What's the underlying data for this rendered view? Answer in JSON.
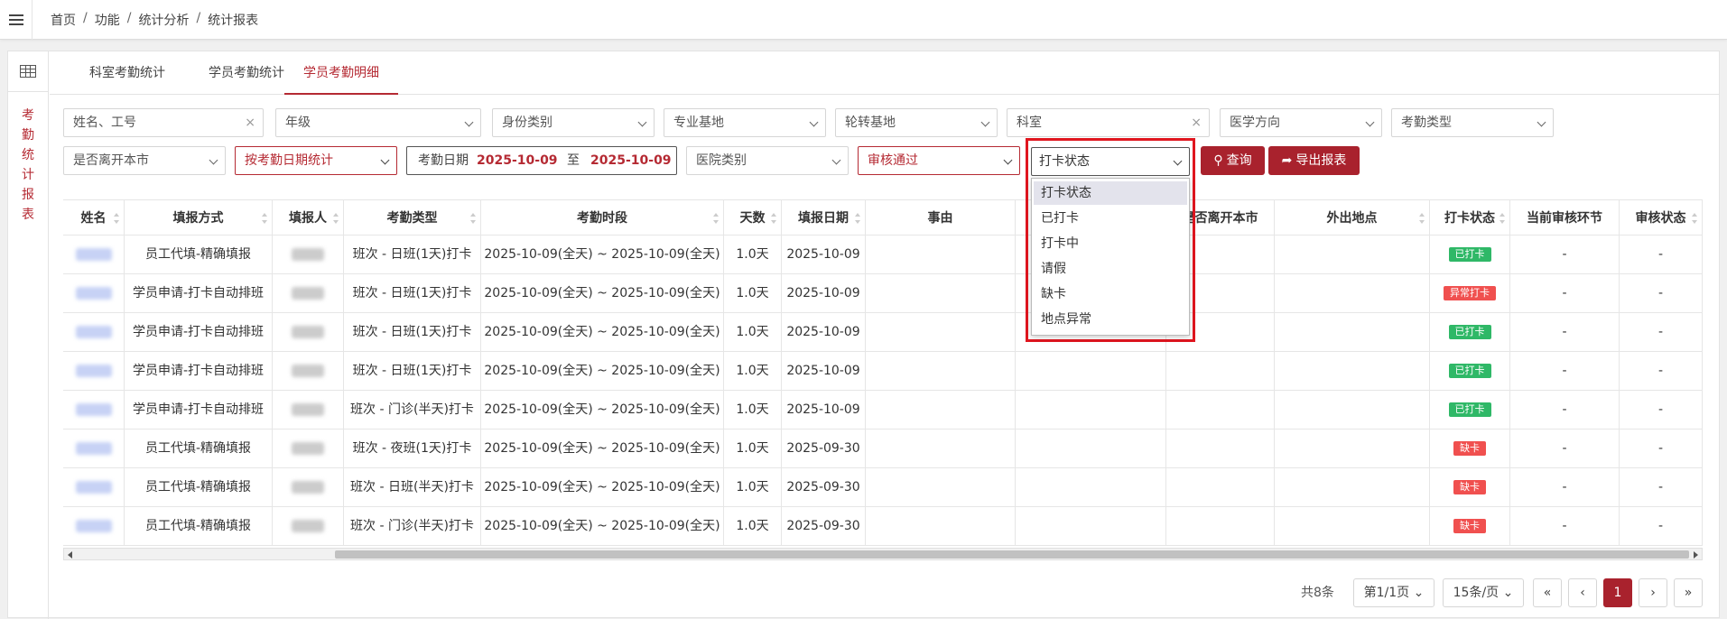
{
  "breadcrumb": [
    "首页",
    "功能",
    "统计分析",
    "统计报表"
  ],
  "breadcrumb_sep": "/",
  "side_vertical": [
    "考",
    "勤",
    "统",
    "计",
    "报",
    "表"
  ],
  "tabs": [
    "科室考勤统计",
    "学员考勤统计",
    "学员考勤明细"
  ],
  "active_tab": 2,
  "filters": {
    "name_placeholder": "姓名、工号",
    "grade": "年级",
    "identity": "身份类别",
    "base": "专业基地",
    "rotation": "轮转基地",
    "dept": "科室",
    "direction": "医学方向",
    "attendance_type": "考勤类型",
    "leave_city": "是否离开本市",
    "stat_mode": "按考勤日期统计",
    "date_label": "考勤日期",
    "date_from": "2025-10-09",
    "date_to_label": "至",
    "date_to": "2025-10-09",
    "hospital_type": "医院类别",
    "audit": "审核通过",
    "clock_status": "打卡状态",
    "clear_icon": "×"
  },
  "buttons": {
    "query": "查询",
    "export": "导出报表"
  },
  "dropdown": {
    "options": [
      "打卡状态",
      "已打卡",
      "打卡中",
      "请假",
      "缺卡",
      "地点异常"
    ],
    "selected": 0
  },
  "table": {
    "headers": [
      "姓名",
      "填报方式",
      "填报人",
      "考勤类型",
      "考勤时段",
      "天数",
      "填报日期",
      "事由",
      "",
      "是否离开本市",
      "外出地点",
      "打卡状态",
      "当前审核环节",
      "审核状态"
    ],
    "rows": [
      [
        "员工代填-精确填报",
        "班次 - 日班(1天)打卡",
        "2025-10-09(全天) ~ 2025-10-09(全天)",
        "1.0天",
        "2025-10-09",
        "已打卡",
        "-",
        "-"
      ],
      [
        "学员申请-打卡自动排班",
        "班次 - 日班(1天)打卡",
        "2025-10-09(全天) ~ 2025-10-09(全天)",
        "1.0天",
        "2025-10-09",
        "异常打卡",
        "-",
        "-"
      ],
      [
        "学员申请-打卡自动排班",
        "班次 - 日班(1天)打卡",
        "2025-10-09(全天) ~ 2025-10-09(全天)",
        "1.0天",
        "2025-10-09",
        "已打卡",
        "-",
        "-"
      ],
      [
        "学员申请-打卡自动排班",
        "班次 - 日班(1天)打卡",
        "2025-10-09(全天) ~ 2025-10-09(全天)",
        "1.0天",
        "2025-10-09",
        "已打卡",
        "-",
        "-"
      ],
      [
        "学员申请-打卡自动排班",
        "班次 - 门诊(半天)打卡",
        "2025-10-09(全天) ~ 2025-10-09(全天)",
        "1.0天",
        "2025-10-09",
        "已打卡",
        "-",
        "-"
      ],
      [
        "员工代填-精确填报",
        "班次 - 夜班(1天)打卡",
        "2025-10-09(全天) ~ 2025-10-09(全天)",
        "1.0天",
        "2025-09-30",
        "缺卡",
        "-",
        "-"
      ],
      [
        "员工代填-精确填报",
        "班次 - 日班(半天)打卡",
        "2025-10-09(全天) ~ 2025-10-09(全天)",
        "1.0天",
        "2025-09-30",
        "缺卡",
        "-",
        "-"
      ],
      [
        "员工代填-精确填报",
        "班次 - 门诊(半天)打卡",
        "2025-10-09(全天) ~ 2025-10-09(全天)",
        "1.0天",
        "2025-09-30",
        "缺卡",
        "-",
        "-"
      ]
    ]
  },
  "status_colors": {
    "已打卡": "#2fb867",
    "异常打卡": "#f0504f",
    "缺卡": "#f0504f"
  },
  "pager": {
    "total": "共8条",
    "page_select": "第1/1页",
    "size_select": "15条/页",
    "first": "«",
    "prev": "‹",
    "current": "1",
    "next": "›",
    "last": "»"
  },
  "accent_color": "#a9222d"
}
